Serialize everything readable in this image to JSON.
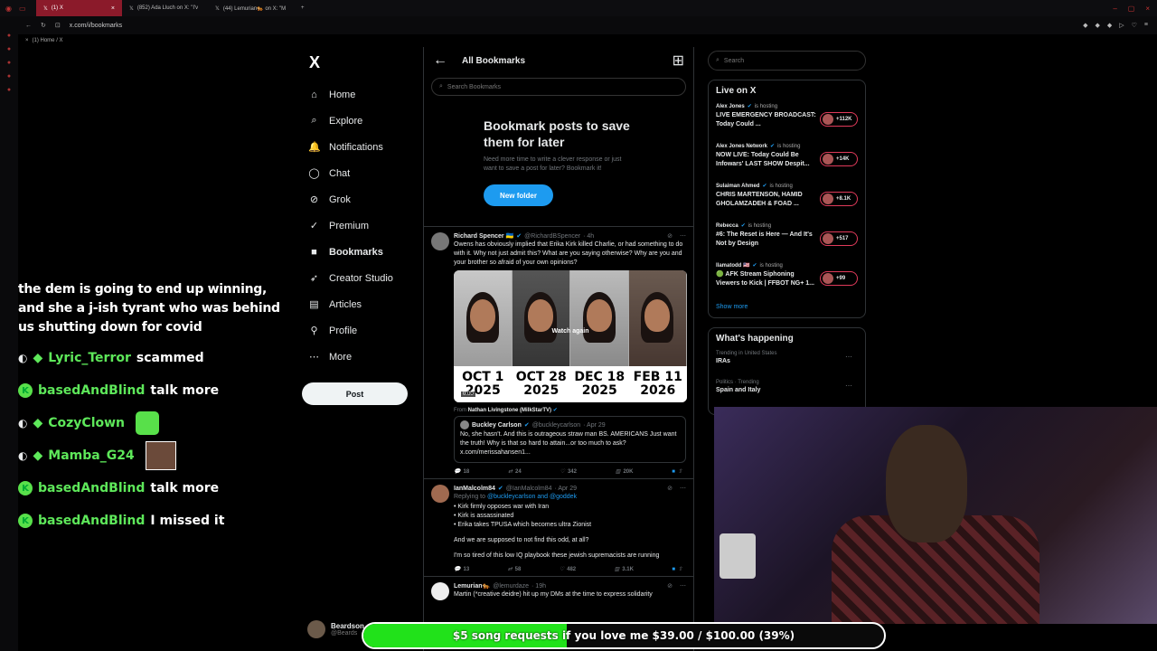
{
  "browser": {
    "tabs": [
      {
        "label": "(1) X",
        "active": true
      },
      {
        "label": "(852) Ada Lluch on X: \"I'v",
        "active": false
      },
      {
        "label": "(44) Lemurian🐅 on X: \"M",
        "active": false
      }
    ],
    "url": "x.com/i/bookmarks",
    "breadcrumb": "(1) Home / X",
    "accent": "#8b1a2a"
  },
  "nav": {
    "logo": "X",
    "items": [
      {
        "label": "Home",
        "icon": "home-icon",
        "glyph": "⌂"
      },
      {
        "label": "Explore",
        "icon": "search-icon",
        "glyph": "⌕"
      },
      {
        "label": "Notifications",
        "icon": "bell-icon",
        "glyph": "🔔"
      },
      {
        "label": "Chat",
        "icon": "chat-icon",
        "glyph": "◯"
      },
      {
        "label": "Grok",
        "icon": "grok-icon",
        "glyph": "⊘"
      },
      {
        "label": "Premium",
        "icon": "premium-icon",
        "glyph": "✓"
      },
      {
        "label": "Bookmarks",
        "icon": "bookmark-icon",
        "glyph": "■",
        "active": true
      },
      {
        "label": "Creator Studio",
        "icon": "rocket-icon",
        "glyph": "➶"
      },
      {
        "label": "Articles",
        "icon": "articles-icon",
        "glyph": "▤"
      },
      {
        "label": "Profile",
        "icon": "profile-icon",
        "glyph": "⚲"
      },
      {
        "label": "More",
        "icon": "more-icon",
        "glyph": "⋯"
      }
    ],
    "post_label": "Post",
    "account_name": "Beardson",
    "account_handle": "@Beards"
  },
  "bookmarks": {
    "title": "All Bookmarks",
    "search_placeholder": "Search Bookmarks",
    "empty_title": "Bookmark posts to save them for later",
    "empty_desc": "Need more time to write a clever response or just want to save a post for later? Bookmark it!",
    "new_folder": "New folder"
  },
  "posts": [
    {
      "name": "Richard Spencer 🇺🇦",
      "handle": "@RichardBSpencer",
      "time": "· 4h",
      "text": "Owens has obviously implied that Erika Kirk killed Charlie, or had something to do with it.   Why not just admit this? What are you saying otherwise? Why are you and your brother so afraid of your own opinions?",
      "media": {
        "watch_again": "Watch again",
        "timecode": "0:00",
        "dates": [
          [
            "OCT 1",
            "2025"
          ],
          [
            "OCT 28",
            "2025"
          ],
          [
            "DEC 18",
            "2025"
          ],
          [
            "FEB 11",
            "2026"
          ]
        ]
      },
      "from_label": "From",
      "from": "Nathan Livingstone (MilkStarTV)",
      "quote": {
        "name": "Buckley Carlson",
        "handle": "@buckleycarlson",
        "time": "· Apr 29",
        "text": "No, she hasn't. And this is outrageous straw man BS. AMERICANS Just want the truth! Why is that so hard to attain...or too much to ask? x.com/merissahansen1..."
      },
      "stats": {
        "replies": "18",
        "reposts": "24",
        "likes": "342",
        "views": "20K"
      }
    },
    {
      "name": "IanMalcolm84",
      "handle": "@IanMalcolm84",
      "time": "· Apr 29",
      "replying_label": "Replying to",
      "replying_to": "@buckleycarlson and @goddek",
      "lines": [
        "• Kirk firmly opposes war with Iran",
        "• Kirk is assassinated",
        "• Erika takes TPUSA which becomes ultra Zionist",
        "And we are supposed to not find this odd, at all?",
        "I'm so tired of this low IQ playbook these jewish supremacists are running"
      ],
      "stats": {
        "replies": "13",
        "reposts": "58",
        "likes": "482",
        "views": "3.1K"
      }
    },
    {
      "name": "Lemurian🐅",
      "handle": "@lemurdaze",
      "time": "· 19h",
      "text": "Martin (*creative deidre) hit up my DMs at the time to express solidarity"
    }
  ],
  "right": {
    "search_placeholder": "Search",
    "live_title": "Live on X",
    "hosting_label": "is hosting",
    "live": [
      {
        "host": "Alex Jones",
        "title": "LIVE EMERGENCY BROADCAST: Today Could ...",
        "count": "+112K"
      },
      {
        "host": "Alex Jones Network",
        "title": "NOW LIVE: Today Could Be Infowars' LAST SHOW Despit...",
        "count": "+14K"
      },
      {
        "host": "Sulaiman Ahmed",
        "title": "CHRIS MARTENSON, HAMID GHOLAMZADEH & FOAD ...",
        "count": "+8.1K"
      },
      {
        "host": "Rebecca",
        "title": "#6: The Reset is Here — And It's Not by Design",
        "count": "+517"
      },
      {
        "host": "llamatodd 🇺🇸",
        "title": "🟢 AFK Stream Siphoning Viewers to Kick | FFBOT NG+ 1...",
        "count": "+99"
      }
    ],
    "show_more": "Show more",
    "happening_title": "What's happening",
    "trends": [
      {
        "category": "Trending in United States",
        "name": "IRAs"
      },
      {
        "category": "Politics · Trending",
        "name": "Spain and Italy"
      }
    ]
  },
  "stream": {
    "chat_top": "the dem is going to end up winning, and she a j-ish tyrant who was behind us shutting down for covid",
    "messages": [
      {
        "user": "Lyric_Terror",
        "msg": "scammed",
        "badge": "diamond"
      },
      {
        "user": "basedAndBlind",
        "msg": "talk more",
        "badge": "kick"
      },
      {
        "user": "CozyClown",
        "msg": "",
        "badge": "diamond",
        "emote": true
      },
      {
        "user": "Mamba_G24",
        "msg": "",
        "badge": "diamond",
        "emote2": true
      },
      {
        "user": "basedAndBlind",
        "msg": "talk more",
        "badge": "kick"
      },
      {
        "user": "basedAndBlind",
        "msg": "I missed it",
        "badge": "kick"
      }
    ],
    "goal_text": "$5 song requests if you love me $39.00 / $100.00 (39%)",
    "goal_fraction": 0.39,
    "goal_color": "#21e21a"
  }
}
